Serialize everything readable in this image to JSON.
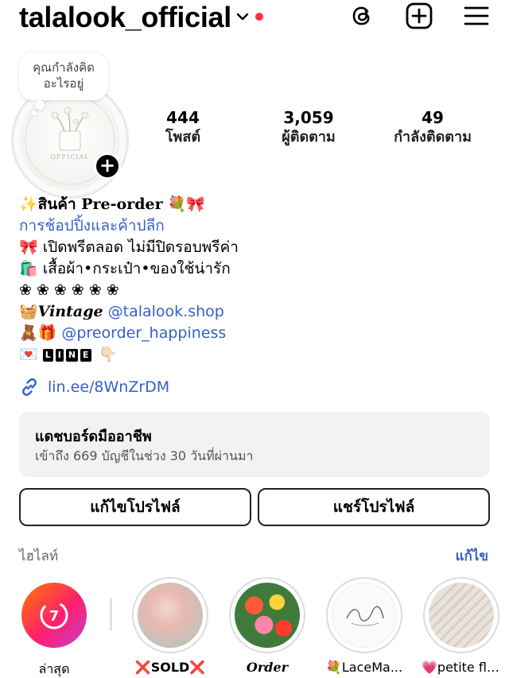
{
  "header": {
    "username": "talalook_official",
    "icons": [
      "chevron-down-icon",
      "threads-icon",
      "plus-square-icon",
      "menu-icon"
    ]
  },
  "note": {
    "text_line1": "คุณกำลังคิด",
    "text_line2": "อะไรอยู่"
  },
  "avatar": {
    "caption": "OFFICIAL"
  },
  "stats": [
    {
      "value": "444",
      "label": "โพสต์"
    },
    {
      "value": "3,059",
      "label": "ผู้ติดตาม"
    },
    {
      "value": "49",
      "label": "กำลังติดตาม"
    }
  ],
  "bio": {
    "line1_prefix": "✨",
    "line1_text": "สินค้า Pre-order",
    "line1_suffix": "💐🎀",
    "category": "การช้อปปิ้งและค้าปลีก",
    "line2": "🎀 เปิดพรีตลอด ไม่มีปิดรอบพรีค่า",
    "line3": "🛍️ เสื้อผ้า•กระเป๋า•ของใช้น่ารัก",
    "line4": "❀ ❀ ❀ ❀ ❀ ❀",
    "line5_prefix": "🧺",
    "line5_vintage": "Vintage",
    "line5_mention": "@talalook.shop",
    "line6_prefix": "🧸🎁",
    "line6_mention": "@preorder_happiness",
    "line7_prefix": "💌",
    "line7_badges": [
      "L",
      "I",
      "N",
      "E"
    ],
    "line7_suffix": "👇🏻",
    "link": "lin.ee/8WnZrDM"
  },
  "dashboard": {
    "title": "แดชบอร์ดมืออาชีพ",
    "subtitle": "เข้าถึง 669 บัญชีในช่วง 30 วันที่ผ่านมา"
  },
  "buttons": {
    "edit_profile": "แก้ไขโปรไฟล์",
    "share_profile": "แชร์โปรไฟล์"
  },
  "highlights": {
    "title": "ไฮไลท์",
    "edit": "แก้ไข",
    "items": [
      {
        "label": "ล่าสุด"
      },
      {
        "label": "❌SOLD❌"
      },
      {
        "label": "Order"
      },
      {
        "label": "💐LaceMa..."
      },
      {
        "label": "💗petite fle..."
      }
    ]
  },
  "colors": {
    "link_blue": "#3560c9",
    "notification_red": "#ff3040",
    "dashboard_bg": "#f2f2f2"
  }
}
